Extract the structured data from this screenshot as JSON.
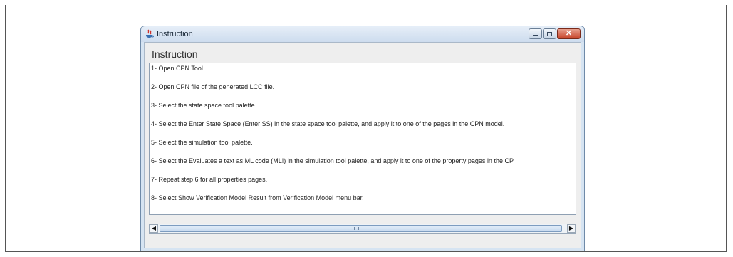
{
  "window": {
    "title": "Instruction",
    "icon": "java-icon",
    "controls": [
      "minimize-icon",
      "maximize-icon",
      "close-icon"
    ]
  },
  "content": {
    "heading": "Instruction",
    "lines": [
      "1- Open CPN Tool.",
      "2- Open CPN file of the generated LCC file.",
      "3- Select the state space tool palette.",
      "4- Select the Enter State Space (Enter SS) in the state space tool palette, and apply it to one of the pages in the CPN model.",
      "5- Select the simulation tool palette.",
      "6- Select the Evaluates a text as ML code (ML!) in the simulation  tool palette, and apply it to one of the property pages in the CP",
      "7- Repeat step 6 for all  properties pages.",
      "8- Select Show Verification Model Result from Verification Model menu bar."
    ]
  },
  "colors": {
    "titlebar": "#d6e4f2",
    "close_button": "#c7442a",
    "text": "#222222"
  }
}
